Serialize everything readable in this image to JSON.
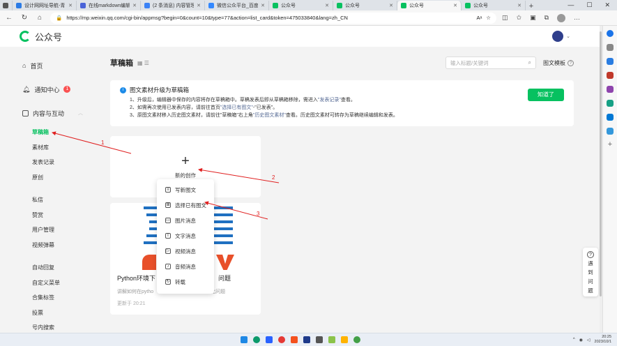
{
  "browser": {
    "tabs": [
      {
        "title": "设计网网址导航-青",
        "color": "#2c7be5",
        "active": false
      },
      {
        "title": "在线markdown编辑",
        "color": "#4a63d8",
        "active": false
      },
      {
        "title": "(2 条消息) 内容管理",
        "color": "#3b82f6",
        "active": false
      },
      {
        "title": "微信公众平台_百度",
        "color": "#3388ff",
        "active": false
      },
      {
        "title": "公众号",
        "color": "#07c160",
        "active": false
      },
      {
        "title": "公众号",
        "color": "#07c160",
        "active": false
      },
      {
        "title": "公众号",
        "color": "#07c160",
        "active": true
      },
      {
        "title": "公众号",
        "color": "#07c160",
        "active": false
      }
    ],
    "new_tab": "+",
    "url": "https://mp.weixin.qq.com/cgi-bin/appmsg?begin=0&count=10&type=77&action=list_card&token=475033840&lang=zh_CN",
    "read_aloud": "Aᵃ"
  },
  "header": {
    "logo_text": "公众号"
  },
  "sidebar": {
    "home": "首页",
    "notifications": "通知中心",
    "notifications_count": "1",
    "content": "内容与互动",
    "items_group1": [
      "草稿箱",
      "素材库",
      "发表记录",
      "原创"
    ],
    "items_group2": [
      "私信",
      "赞赏",
      "用户管理",
      "视频弹幕"
    ],
    "items_group3": [
      "自动回复",
      "自定义菜单",
      "合集标签",
      "投票",
      "号内搜索"
    ]
  },
  "main": {
    "title": "草稿箱",
    "search_placeholder": "输入标题/关键词",
    "template_label": "图文模板",
    "notice": {
      "title": "图文素材升级为草稿箱",
      "line1_a": "1、升级后，编辑器中保存的内容将存在草稿箱中。草稿发表后即从草稿箱移除，需进入",
      "line1_link": "\"发表记录\"",
      "line1_b": "查看。",
      "line2_a": "2、如需再次使用已发表内容，请前往首页",
      "line2_link": "\"选择已有图文\"",
      "line2_b": "-\"已发表\"。",
      "line3_a": "3、原图文素材移入历史图文素材，请前往\"草稿箱\"右上角",
      "line3_link": "\"历史图文素材\"",
      "line3_b": "查看。历史图文素材可转存为草稿继续编辑和发表。",
      "ok_button": "知道了"
    },
    "create_label": "新的创作",
    "menu": [
      {
        "label": "写新图文",
        "icon": "document-icon"
      },
      {
        "label": "选择已有图文",
        "icon": "select-document-icon"
      },
      {
        "label": "图片消息",
        "icon": "image-icon"
      },
      {
        "label": "文字消息",
        "icon": "text-icon"
      },
      {
        "label": "视频消息",
        "icon": "video-icon"
      },
      {
        "label": "音频消息",
        "icon": "audio-icon"
      },
      {
        "label": "转载",
        "icon": "repost-icon"
      }
    ],
    "article": {
      "title_a": "Python环境下",
      "title_b": "问题",
      "desc_a": "讲解如何在pytho",
      "desc_b": "性优化问题",
      "time": "更新于 20:21"
    }
  },
  "help": {
    "q": "?",
    "text": [
      "遇",
      "到",
      "问",
      "题"
    ]
  },
  "annotations": [
    "1",
    "2",
    "3"
  ],
  "taskbar": {
    "time": "20:25",
    "date": "2023/10/1"
  },
  "colors": {
    "brand_green": "#07c160",
    "annotation_red": "#e02020",
    "link_blue": "#576b95"
  }
}
